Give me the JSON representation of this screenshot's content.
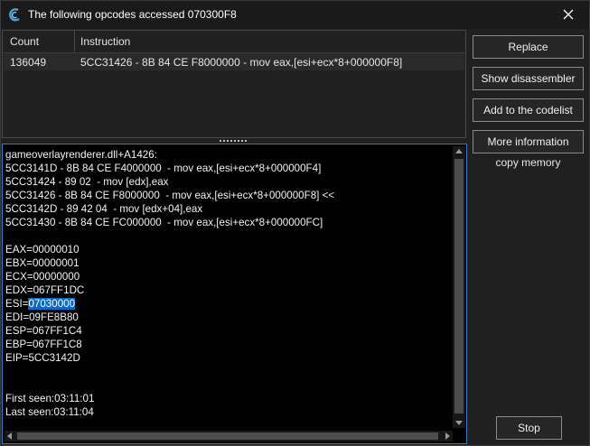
{
  "window": {
    "title": "The following opcodes accessed 070300F8",
    "app_icon": "cheat-engine-icon",
    "close_icon": "close-icon"
  },
  "opcode_list": {
    "columns": [
      "Count",
      "Instruction"
    ],
    "rows": [
      {
        "count": "136049",
        "instruction": "5CC31426 - 8B 84 CE F8000000  - mov eax,[esi+ecx*8+000000F8]"
      }
    ]
  },
  "details": {
    "module_line": "gameoverlayrenderer.dll+A1426:",
    "disasm": [
      "5CC3141D - 8B 84 CE F4000000  - mov eax,[esi+ecx*8+000000F4]",
      "5CC31424 - 89 02  - mov [edx],eax",
      "5CC31426 - 8B 84 CE F8000000  - mov eax,[esi+ecx*8+000000F8] <<",
      "5CC3142D - 89 42 04  - mov [edx+04],eax",
      "5CC31430 - 8B 84 CE FC000000  - mov eax,[esi+ecx*8+000000FC]"
    ],
    "registers": {
      "eax": "EAX=00000010",
      "ebx": "EBX=00000001",
      "ecx": "ECX=00000000",
      "edx": "EDX=067FF1DC",
      "esi_label": "ESI=",
      "esi_value": "07030000",
      "edi": "EDI=09FE8B80",
      "esp": "ESP=067FF1C4",
      "ebp": "EBP=067FF1C8",
      "eip": "EIP=5CC3142D"
    },
    "first_seen": "First seen:03:11:01",
    "last_seen": "Last seen:03:11:04"
  },
  "buttons": {
    "replace": "Replace",
    "show_disassembler": "Show disassembler",
    "add_to_codelist": "Add to the codelist",
    "more_information": "More information",
    "copy_memory": "copy memory",
    "stop": "Stop"
  },
  "colors": {
    "background": "#202020",
    "memo_background": "#000000",
    "selection": "#0a6ac8",
    "focus_border": "#2b7fbf"
  }
}
